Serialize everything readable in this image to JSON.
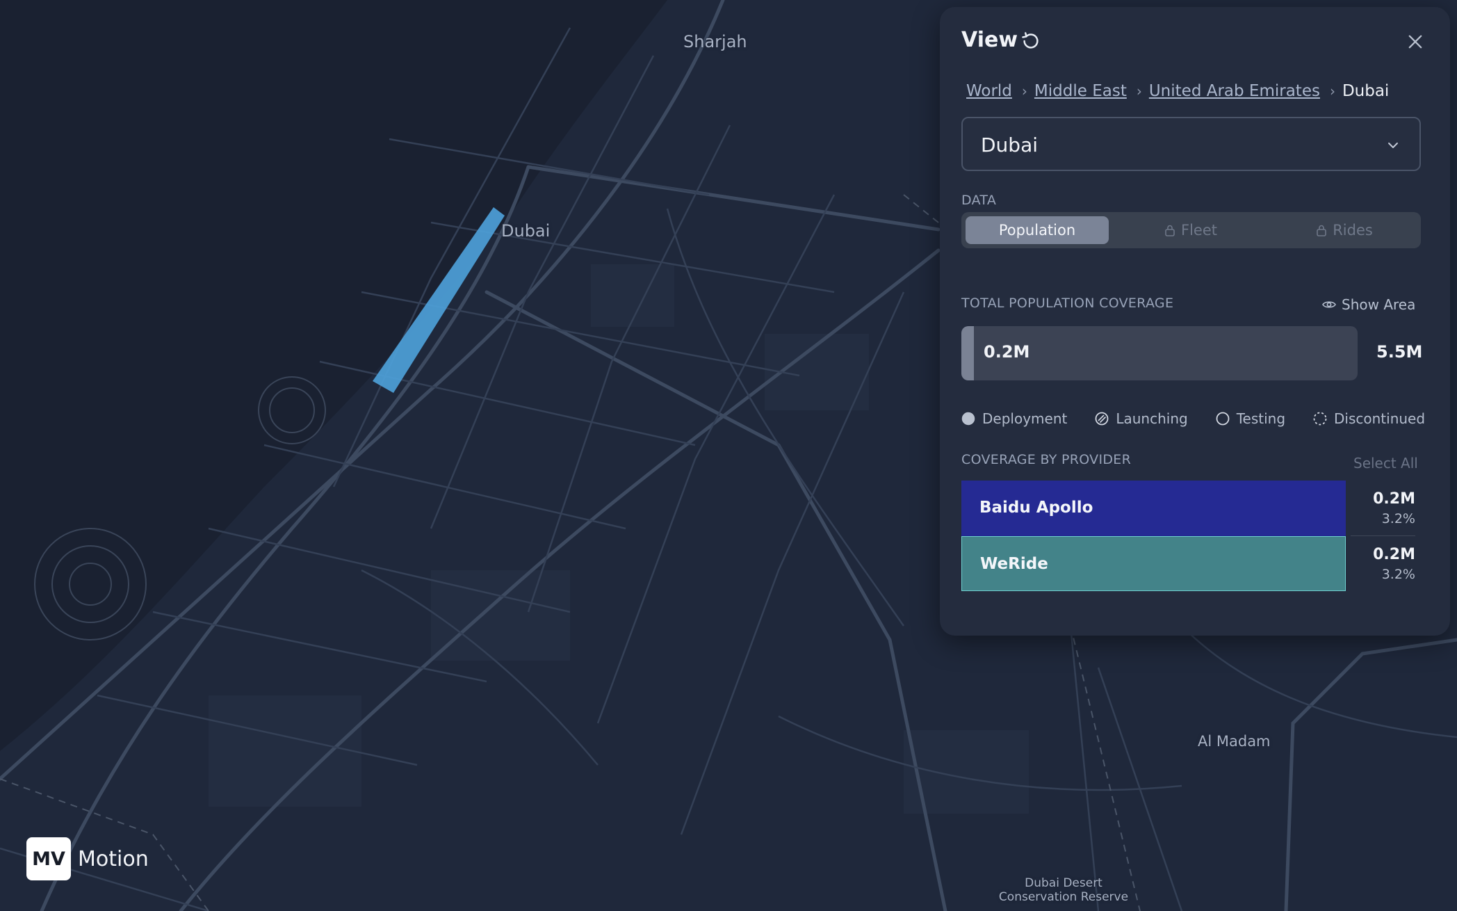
{
  "map": {
    "labels": {
      "sharjah": "Sharjah",
      "dubai": "Dubai",
      "al_madam": "Al Madam",
      "reserve_line1": "Dubai Desert",
      "reserve_line2": "Conservation Reserve"
    }
  },
  "panel": {
    "title": "View",
    "breadcrumb": {
      "world": "World",
      "region": "Middle East",
      "country": "United Arab Emirates",
      "current": "Dubai"
    },
    "region_select": {
      "value": "Dubai"
    },
    "data_section_label": "DATA",
    "tabs": {
      "population": "Population",
      "fleet": "Fleet",
      "rides": "Rides"
    },
    "coverage": {
      "label": "TOTAL POPULATION COVERAGE",
      "show_area": "Show Area",
      "value": "0.2M",
      "max": "5.5M",
      "fill_fraction": 0.032
    },
    "legend": {
      "deployment": "Deployment",
      "launching": "Launching",
      "testing": "Testing",
      "discontinued": "Discontinued"
    },
    "provider_section": {
      "label": "COVERAGE BY PROVIDER",
      "select_all": "Select All"
    },
    "providers": [
      {
        "name": "Baidu Apollo",
        "value": "0.2M",
        "percent": "3.2%",
        "color": "#252a93"
      },
      {
        "name": "WeRide",
        "value": "0.2M",
        "percent": "3.2%",
        "color": "#438389"
      }
    ]
  },
  "colors": {
    "route_highlight": "#4d9fd8",
    "panel_bg": "#242c3e",
    "map_bg": "#1e2638"
  },
  "logo": {
    "badge": "MV",
    "name": "Motion"
  }
}
